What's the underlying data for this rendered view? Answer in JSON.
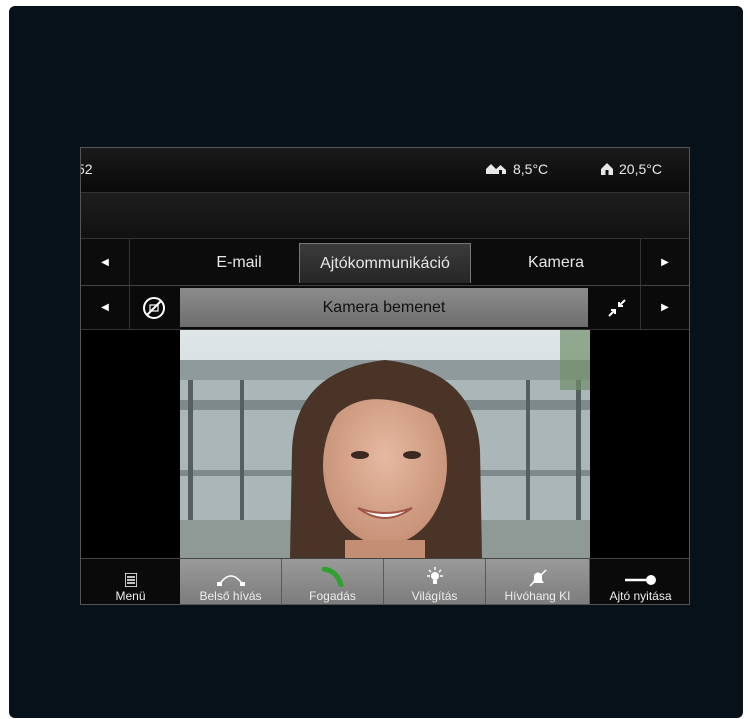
{
  "status": {
    "time": "52",
    "outdoor_temp": "8,5°C",
    "indoor_temp": "20,5°C",
    "outdoor_icon": "houses-icon",
    "indoor_icon": "house-icon"
  },
  "tabs": {
    "prev_icon": "triangle-left-icon",
    "next_icon": "triangle-right-icon",
    "items": [
      {
        "label": "E-mail",
        "active": false
      },
      {
        "label": "Ajtókommunikáció",
        "active": true
      },
      {
        "label": "Kamera",
        "active": false
      }
    ]
  },
  "camera": {
    "title": "Kamera bemenet",
    "no_image_icon": "no-image-icon",
    "expand_icon": "shrink-arrows-icon"
  },
  "bottom": {
    "buttons": [
      {
        "label": "Menü",
        "icon": "menu-icon"
      },
      {
        "label": "Belső hívás",
        "icon": "internal-call-icon"
      },
      {
        "label": "Fogadás",
        "icon": "accept-call-icon"
      },
      {
        "label": "Világítás",
        "icon": "light-bulb-icon"
      },
      {
        "label": "Hívóhang KI",
        "icon": "bell-off-icon"
      },
      {
        "label": "Ajtó nyitása",
        "icon": "key-icon"
      }
    ]
  },
  "colors": {
    "device_bg": "#07111a",
    "accept_green": "#2fa12f",
    "title_bar": "#7e7e7e"
  }
}
